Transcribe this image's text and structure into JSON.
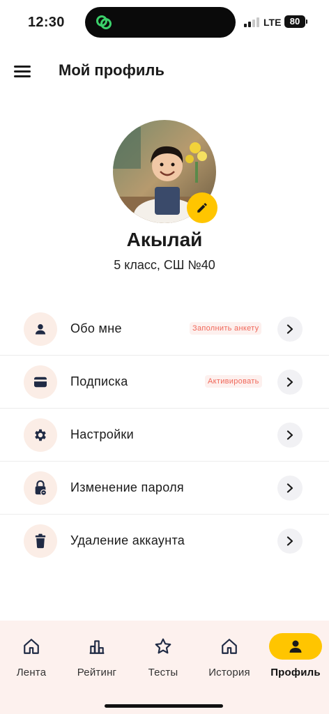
{
  "status_bar": {
    "time": "12:30",
    "network": "LTE",
    "battery": "80"
  },
  "header": {
    "title": "Мой профиль"
  },
  "profile": {
    "name": "Акылай",
    "school": "5 класс, СШ №40"
  },
  "menu": [
    {
      "icon": "person-icon",
      "label": "Обо мне",
      "badge": "Заполнить анкету"
    },
    {
      "icon": "card-icon",
      "label": "Подписка",
      "badge": "Активировать"
    },
    {
      "icon": "gear-icon",
      "label": "Настройки",
      "badge": ""
    },
    {
      "icon": "lock-icon",
      "label": "Изменение пароля",
      "badge": ""
    },
    {
      "icon": "trash-icon",
      "label": "Удаление аккаунта",
      "badge": ""
    }
  ],
  "bottom_nav": [
    {
      "icon": "home-icon",
      "label": "Лента",
      "active": false
    },
    {
      "icon": "bar-chart-icon",
      "label": "Рейтинг",
      "active": false
    },
    {
      "icon": "star-icon",
      "label": "Тесты",
      "active": false
    },
    {
      "icon": "home-icon",
      "label": "История",
      "active": false
    },
    {
      "icon": "person-icon",
      "label": "Профиль",
      "active": true
    }
  ],
  "colors": {
    "accent": "#FFC500",
    "badge_text": "#F0685A",
    "icon_bg": "#FBEDE6",
    "nav_bg": "#FDF1EE"
  }
}
